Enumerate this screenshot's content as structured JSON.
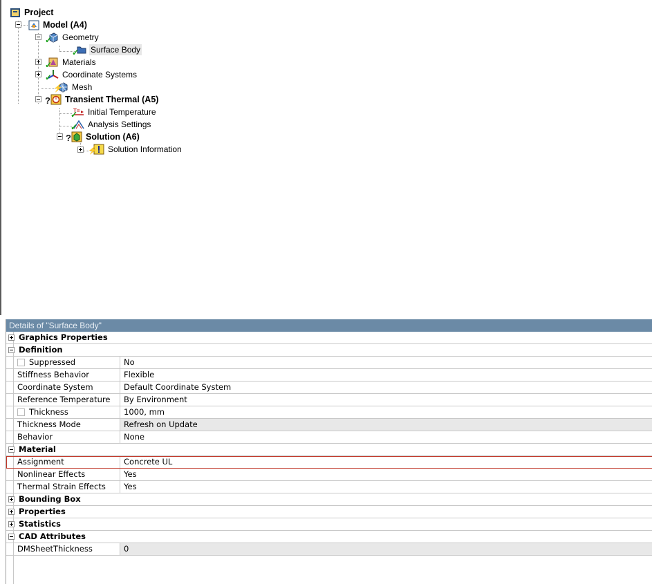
{
  "tree": {
    "project": "Project",
    "model": "Model (A4)",
    "geometry": "Geometry",
    "surface_body": "Surface Body",
    "materials": "Materials",
    "coordinate_systems": "Coordinate Systems",
    "mesh": "Mesh",
    "transient_thermal": "Transient Thermal (A5)",
    "initial_temperature": "Initial Temperature",
    "analysis_settings": "Analysis Settings",
    "solution": "Solution (A6)",
    "solution_information": "Solution Information"
  },
  "details": {
    "header": "Details of \"Surface Body\"",
    "graphics_properties": "Graphics Properties",
    "definition": "Definition",
    "suppressed": {
      "name": "Suppressed",
      "value": "No"
    },
    "stiffness": {
      "name": "Stiffness Behavior",
      "value": "Flexible"
    },
    "coord": {
      "name": "Coordinate System",
      "value": "Default Coordinate System"
    },
    "reftemp": {
      "name": "Reference Temperature",
      "value": "By Environment"
    },
    "thickness": {
      "name": "Thickness",
      "value": "1000, mm"
    },
    "thickness_mode": {
      "name": "Thickness Mode",
      "value": "Refresh on Update"
    },
    "behavior": {
      "name": "Behavior",
      "value": "None"
    },
    "material": "Material",
    "assignment": {
      "name": "Assignment",
      "value": "Concrete UL"
    },
    "nonlinear": {
      "name": "Nonlinear Effects",
      "value": "Yes"
    },
    "thermal_strain": {
      "name": "Thermal Strain Effects",
      "value": "Yes"
    },
    "bounding_box": "Bounding Box",
    "properties": "Properties",
    "statistics": "Statistics",
    "cad_attributes": "CAD Attributes",
    "dmsheet": {
      "name": "DMSheetThickness",
      "value": "0"
    }
  },
  "colors": {
    "header_bg": "#6b8aa6",
    "highlight": "#c0392b",
    "check": "#18a018"
  }
}
